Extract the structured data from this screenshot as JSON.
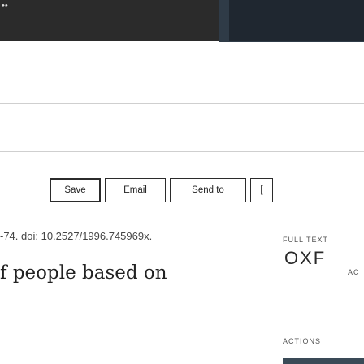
{
  "toolbar": {
    "buttons": [
      {
        "label": "Save"
      },
      {
        "label": "Email"
      },
      {
        "label": "Send to"
      },
      {
        "label": "["
      }
    ]
  },
  "article": {
    "citation": "-74. doi: 10.2527/1996.745969x.",
    "title_fragment": "f people based on"
  },
  "sidebar": {
    "full_text_label": "FULL TEXT",
    "provider_logo": "OXF",
    "provider_logo_sub": "AC",
    "actions_label": "ACTIONS"
  },
  "colors": {
    "header_bg": "#2b2b2b",
    "hero_bg": "#2f3b47",
    "accent": "#3a4a57"
  },
  "icons": {
    "top_left": "logo-icon"
  }
}
